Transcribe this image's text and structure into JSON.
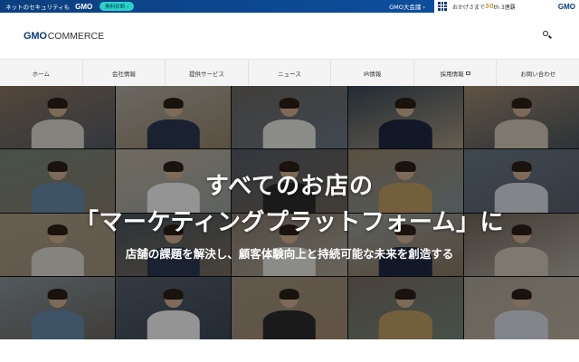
{
  "topbar": {
    "left_text": "ネットのセキュリティも",
    "left_brand": "GMO",
    "pill": "無料診断 ›",
    "meeting": "GMO大会議 ›",
    "right_text": "おかげさまで",
    "right_30": "30",
    "right_suffix": "th 3連覇",
    "right_brand": "GMO"
  },
  "header": {
    "logo_gmo": "GMO",
    "logo_commerce": "COMMERCE"
  },
  "nav": {
    "items": [
      {
        "label": "ホーム"
      },
      {
        "label": "会社情報"
      },
      {
        "label": "提供サービス"
      },
      {
        "label": "ニュース"
      },
      {
        "label": "IR情報"
      },
      {
        "label": "採用情報"
      },
      {
        "label": "お問い合わせ"
      }
    ]
  },
  "hero": {
    "title_line1": "すべてのお店の",
    "title_line2": "「マーケティングプラットフォーム」に",
    "subtitle": "店舗の課題を解決し、顧客体験向上と持続可能な未来を創造する"
  },
  "colors": {
    "brand_blue": "#0b3a78",
    "accent_teal": "#2bd2c9",
    "nav_bg": "#f4f4f4"
  }
}
